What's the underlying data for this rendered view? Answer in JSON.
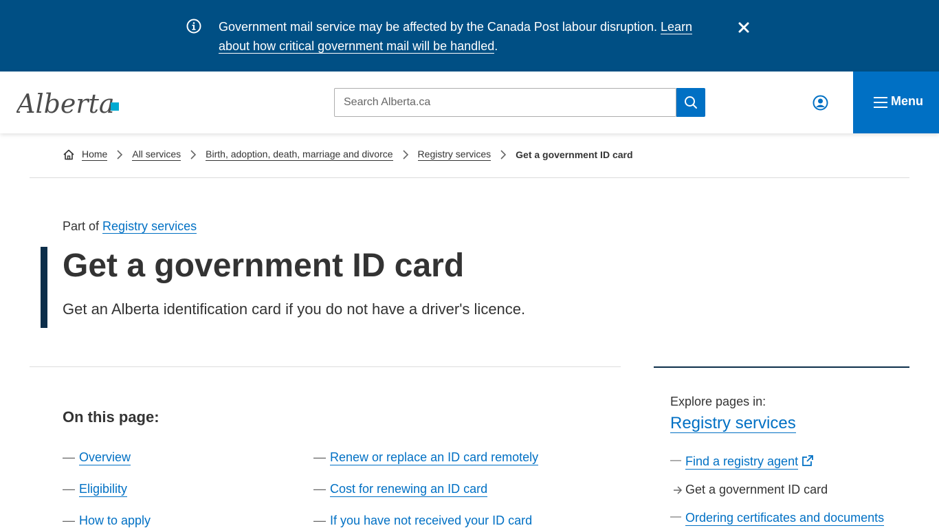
{
  "alert": {
    "message": "Government mail service may be affected by the Canada Post labour disruption.",
    "link_text": "Learn about how critical government mail will be handled",
    "trailing": "."
  },
  "header": {
    "logo_text": "Alberta",
    "search_placeholder": "Search Alberta.ca",
    "menu_label": "Menu"
  },
  "breadcrumb": {
    "items": [
      "Home",
      "All services",
      "Birth, adoption, death, marriage and divorce",
      "Registry services"
    ],
    "current": "Get a government ID card"
  },
  "page": {
    "part_of_label": "Part of",
    "part_of_link": "Registry services",
    "title": "Get a government ID card",
    "lead": "Get an Alberta identification card if you do not have a driver's licence."
  },
  "on_this_page": {
    "heading": "On this page:",
    "left": [
      "Overview",
      "Eligibility",
      "How to apply"
    ],
    "right": [
      "Renew or replace an ID card remotely",
      "Cost for renewing an ID card",
      "If you have not received your ID card"
    ]
  },
  "sidebar": {
    "label": "Explore pages in:",
    "title": "Registry services",
    "items": [
      {
        "text": "Find a registry agent",
        "icon": "external-link-icon"
      },
      {
        "text": "Get a government ID card",
        "icon": "arrow-right-icon"
      },
      {
        "text": "Ordering certificates and documents",
        "icon": "dash"
      }
    ]
  },
  "colors": {
    "alert_bg": "#004f84",
    "primary_blue": "#0070c4",
    "title_bar": "#0c2e4a",
    "logo_accent": "#00aad2"
  }
}
